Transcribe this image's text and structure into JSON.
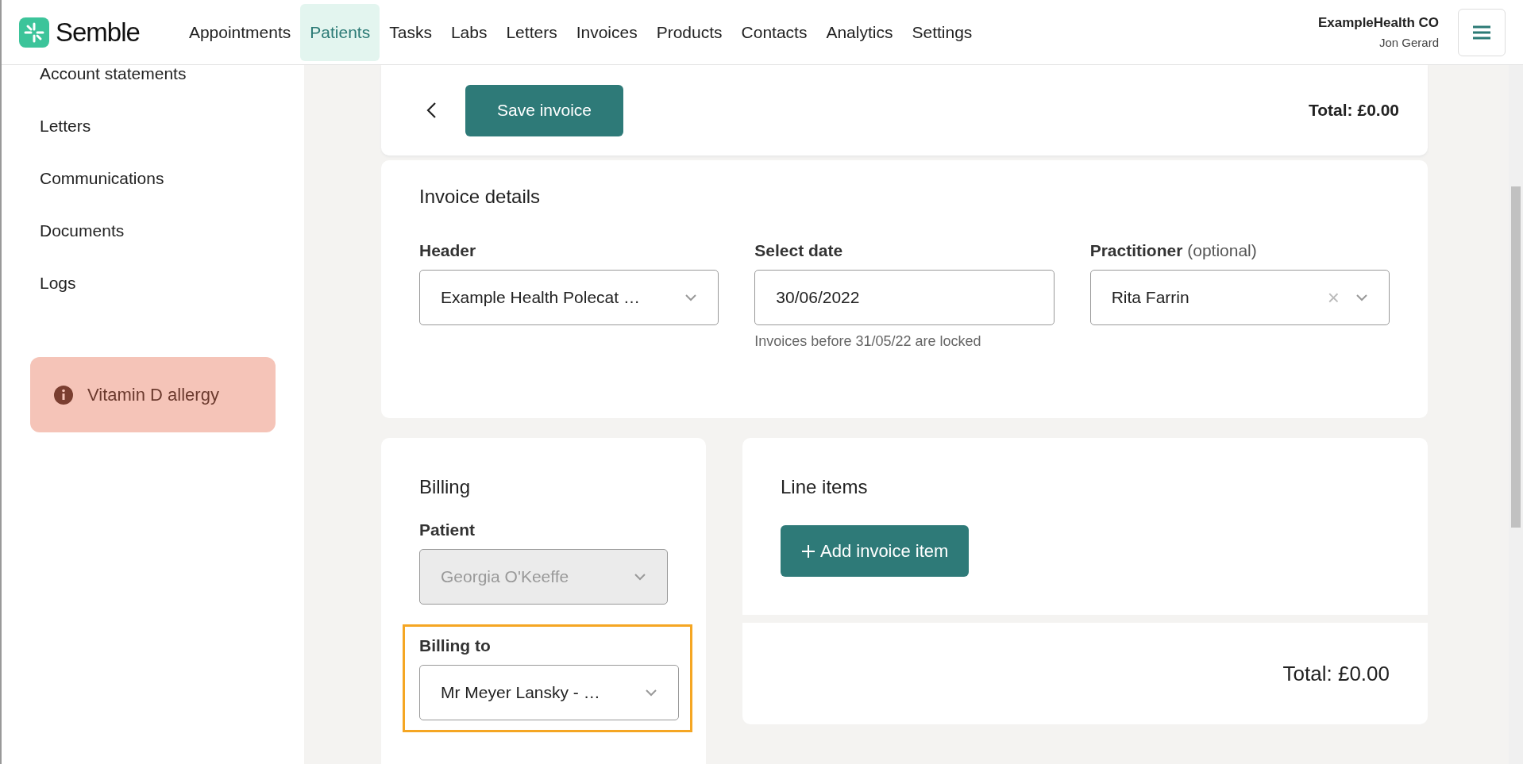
{
  "topbar": {
    "logo": "Semble",
    "nav": [
      {
        "label": "Appointments",
        "selected": false
      },
      {
        "label": "Patients",
        "selected": true
      },
      {
        "label": "Tasks",
        "selected": false
      },
      {
        "label": "Labs",
        "selected": false
      },
      {
        "label": "Letters",
        "selected": false
      },
      {
        "label": "Invoices",
        "selected": false
      },
      {
        "label": "Products",
        "selected": false
      },
      {
        "label": "Contacts",
        "selected": false
      },
      {
        "label": "Analytics",
        "selected": false
      },
      {
        "label": "Settings",
        "selected": false
      }
    ],
    "account": {
      "organisation": "ExampleHealth CO",
      "user": "Jon Gerard"
    }
  },
  "sidebar": {
    "items": [
      "Account statements",
      "Letters",
      "Communications",
      "Documents",
      "Logs"
    ],
    "alert": "Vitamin D allergy"
  },
  "toolbar": {
    "save_button": "Save invoice",
    "total": "Total: £0.00"
  },
  "invoice_details": {
    "title": "Invoice details",
    "fields": [
      {
        "label": "Header",
        "value": "Example Health Polecat …"
      },
      {
        "label": "Select date",
        "value": "30/06/2022",
        "kind": "date",
        "hint": "Invoices before 31/05/22 are locked"
      },
      {
        "label": "Practitioner",
        "label_note": "(optional)",
        "value": "Rita Farrin",
        "clear_icon": "×"
      }
    ]
  },
  "billing": {
    "title": "Billing",
    "fields": [
      {
        "label": "Patient",
        "value": "Georgia O'Keeffe",
        "disabled": true
      },
      {
        "label": "Billing to",
        "value": "Mr Meyer Lansky - …",
        "disabled": false,
        "highlighted": true
      }
    ]
  },
  "line_items": {
    "title": "Line items",
    "add_button": "Add invoice item",
    "total": "Total: £0.00"
  }
}
